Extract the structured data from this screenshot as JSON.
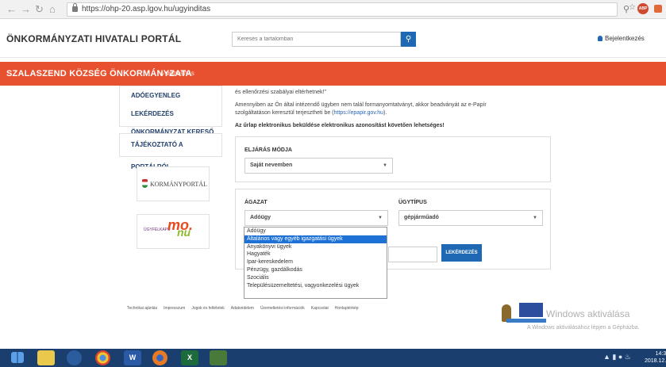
{
  "browser": {
    "url": "https://ohp-20.asp.lgov.hu/ugyinditas",
    "back_icon": "back-arrow",
    "forward_icon": "forward-arrow",
    "reload_icon": "reload",
    "home_icon": "home"
  },
  "header": {
    "portal_title": "ÖNKORMÁNYZATI HIVATALI PORTÁL",
    "search_placeholder": "Keresés a tartalomban",
    "login_label": "Bejelentkezés"
  },
  "banner": {
    "municipality": "SZALASZEND KÖZSÉG ÖNKORMÁNYZATA",
    "modify_label": "MÓDOSÍTÁS",
    "color": "#e8512f"
  },
  "sidebar": {
    "box1": [
      "ADÓEGYENLEG LEKÉRDEZÉS",
      "ÖNKORMÁNYZAT KERESŐ"
    ],
    "box2": [
      "TÁJÉKOZTATÓ A PORTÁLRÓL"
    ],
    "kormanyportal_label": "KORMÁNYPORTÁL",
    "ugyfelkapu_label": "ÜGYFÉLKAPU",
    "mo_label": "mo.",
    "nu_label": "nu"
  },
  "main": {
    "intro_line": "és ellenőrzési szabályai eltérhetnek!\"",
    "info_text_1": "Amennyiben az Ön által intézendő ügyben nem talál formanyomtatványt, akkor beadványát az e-Papír szolgáltatáson keresztül terjesztheti be (",
    "epapir_link": "https://epapir.gov.hu",
    "info_text_2": ").",
    "electronic_note": "Az űrlap elektronikus beküldése elektronikus azonosítást követően lehetséges!",
    "eljaras_label": "ELJÁRÁS MÓDJA",
    "eljaras_value": "Saját nevemben",
    "agazat_label": "ÁGAZAT",
    "agazat_value": "Adóügy",
    "ugytipus_label": "ÜGYTÍPUS",
    "ugytipus_value": "gépjárműadó",
    "query_button": "LEKÉRDEZÉS",
    "dropdown_options": [
      "Adóügy",
      "Általános vagy egyéb igazgatási ügyek",
      "Anyakönyvi ügyek",
      "Hagyaték",
      "Ipar-kereskedelem",
      "Pénzügy, gazdálkodás",
      "Szociális",
      "Településüzemeltetési, vagyonkezelési ügyek"
    ],
    "dropdown_selected_index": 1,
    "dropdown_highlight_color": "#1e72d6"
  },
  "footer": {
    "links": [
      "Technikai ajánlás",
      "Impresszum",
      "Jogok és feltételek",
      "Adatvédelem",
      "Üzemeltetési információk",
      "Kapcsolat",
      "Honlaptérkép"
    ]
  },
  "watermark": {
    "title": "Windows aktiválása",
    "subtitle": "A Windows aktiválásához lépjen a Gépházba."
  },
  "taskbar": {
    "word_label": "W",
    "excel_label": "X",
    "time": "14:39",
    "date": "2018.12.1"
  }
}
